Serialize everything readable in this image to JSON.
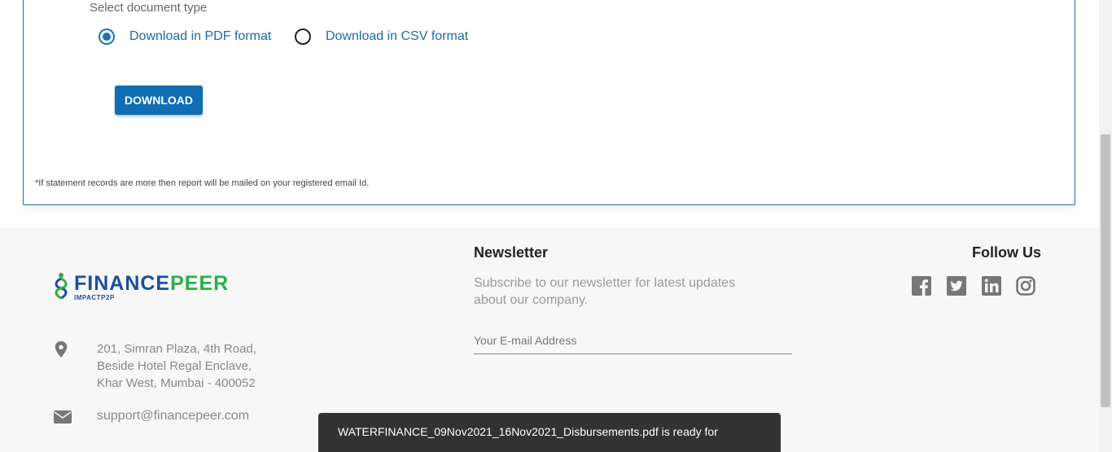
{
  "download_card": {
    "doc_type_label": "Select document type",
    "options": [
      {
        "label": "Download in PDF format",
        "selected": true
      },
      {
        "label": "Download in CSV format",
        "selected": false
      }
    ],
    "download_button": "DOWNLOAD",
    "note": "*If statement records are more then report will be mailed on your registered email Id."
  },
  "footer": {
    "logo": {
      "name_part1": "FINANCE",
      "name_part2": "PEER",
      "sub": "IMPACTP2P"
    },
    "address": {
      "line1": "201, Simran Plaza, 4th Road,",
      "line2": "Beside Hotel Regal Enclave,",
      "line3": "Khar West, Mumbai - 400052",
      "icon": "location-pin-icon"
    },
    "email": {
      "text": "support@financepeer.com",
      "icon": "mail-icon"
    },
    "newsletter": {
      "title": "Newsletter",
      "description": "Subscribe to our newsletter for latest updates about our company.",
      "email_placeholder": "Your E-mail Address",
      "email_value": ""
    },
    "follow": {
      "title": "Follow Us",
      "icons": [
        "facebook-icon",
        "twitter-icon",
        "linkedin-icon",
        "instagram-icon"
      ]
    }
  },
  "toast": {
    "message": "WATERFINANCE_09Nov2021_16Nov2021_Disbursements.pdf is ready for"
  },
  "colors": {
    "accent": "#0f6db4",
    "logo_blue": "#1b4f9c",
    "logo_green": "#2cae4a",
    "toast_bg": "#323232"
  }
}
